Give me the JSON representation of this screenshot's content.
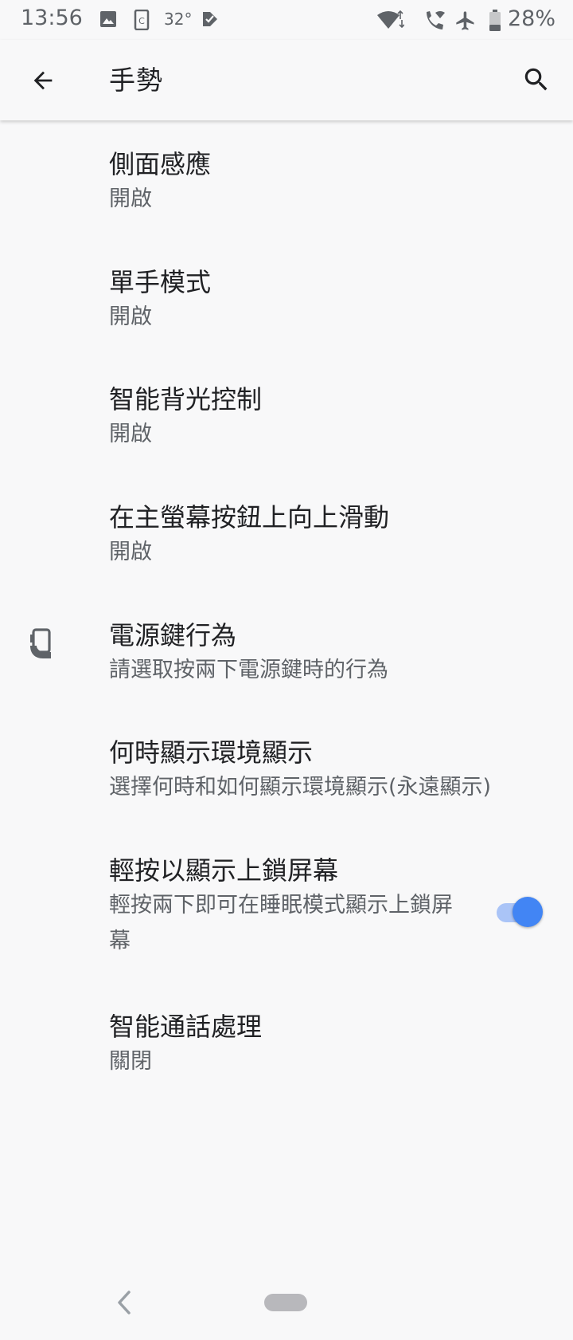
{
  "status_bar": {
    "time": "13:56",
    "temperature": "32°",
    "battery_percent": "28%",
    "icons": [
      "image-icon",
      "screenshot-icon",
      "sim-notification-icon",
      "wifi-icon",
      "wifi-calling-icon",
      "airplane-mode-icon",
      "battery-icon"
    ]
  },
  "app_bar": {
    "title": "手勢",
    "back_icon": "arrow-back-icon",
    "search_icon": "search-icon"
  },
  "settings": [
    {
      "title": "側面感應",
      "summary": "開啟"
    },
    {
      "title": "單手模式",
      "summary": "開啟"
    },
    {
      "title": "智能背光控制",
      "summary": "開啟"
    },
    {
      "title": "在主螢幕按鈕上向上滑動",
      "summary": "開啟"
    },
    {
      "title": "電源鍵行為",
      "summary": "請選取按兩下電源鍵時的行為",
      "icon": "phone-power-icon"
    },
    {
      "title": "何時顯示環境顯示",
      "summary": "選擇何時和如何顯示環境顯示(永遠顯示)"
    },
    {
      "title": "輕按以顯示上鎖屏幕",
      "summary": "輕按兩下即可在睡眠模式顯示上鎖屏幕",
      "toggle": "on"
    },
    {
      "title": "智能通話處理",
      "summary": "關閉"
    }
  ],
  "colors": {
    "accent": "#4285f4",
    "background": "#f8f8f9",
    "title_text": "#202124",
    "summary_text": "#5f6368"
  },
  "nav_bar": {
    "icons": [
      "nav-back-icon",
      "nav-home-pill"
    ]
  }
}
